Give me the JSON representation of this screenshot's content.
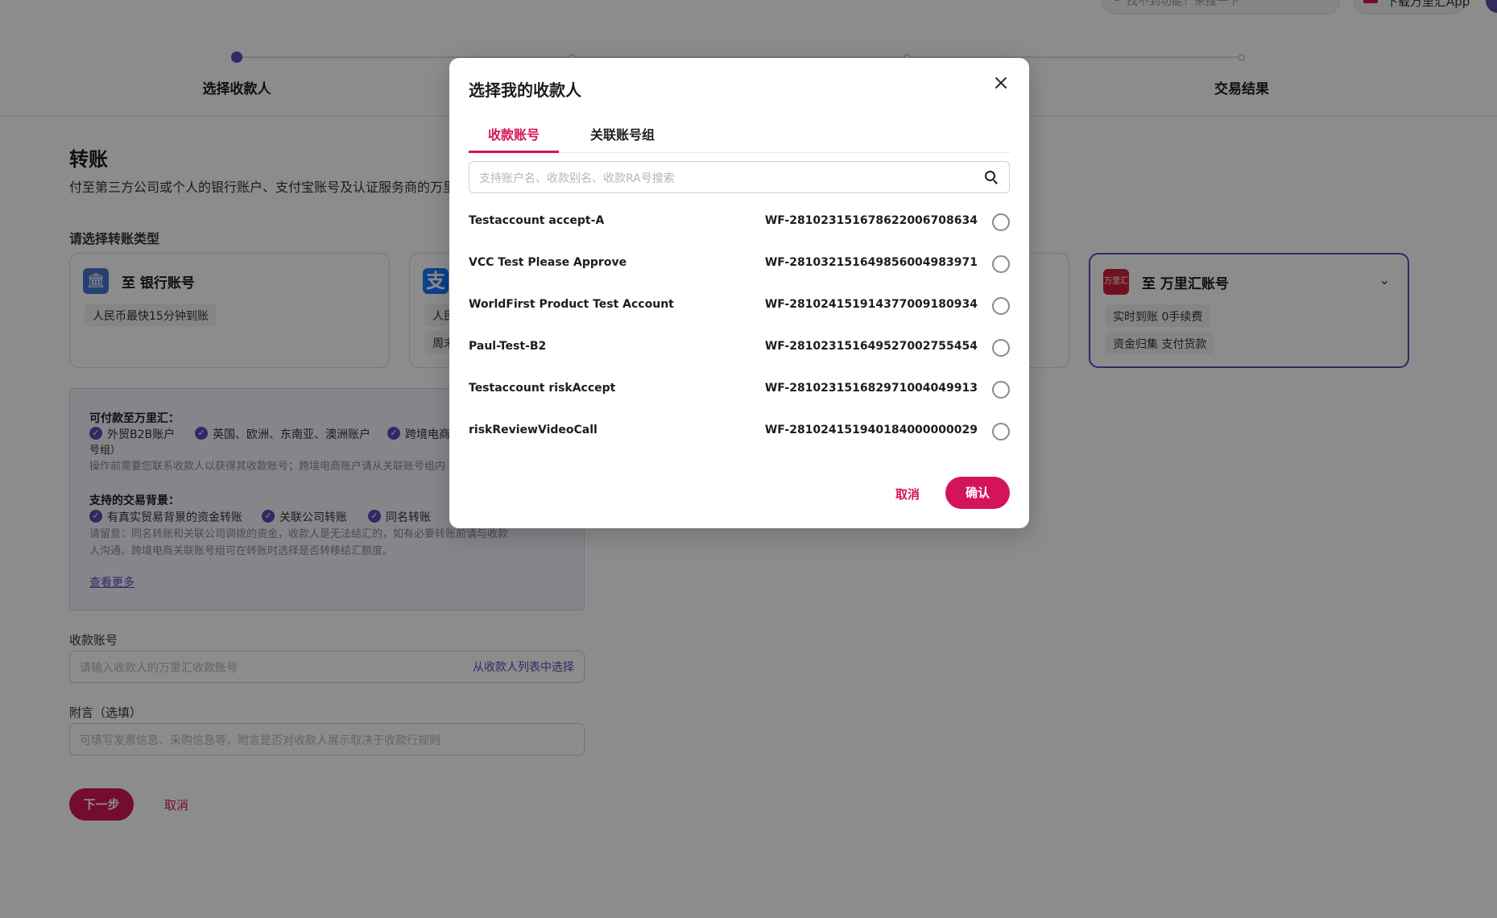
{
  "topbar": {
    "search_text": "找不到功能？来搜一下",
    "app_label": "下载万里汇App"
  },
  "stepper": {
    "steps": [
      {
        "label": "选择收款人"
      },
      {
        "label": ""
      },
      {
        "label": ""
      },
      {
        "label": "交易结果"
      }
    ]
  },
  "page": {
    "title": "转账",
    "description": "付至第三方公司或个人的银行账户、支付宝账号及认证服务商的万里",
    "type_section_label": "请选择转账类型",
    "cards": {
      "bank": {
        "title": "至 银行账号",
        "tags": [
          "人民币最快15分钟到账"
        ]
      },
      "alipay": {
        "tags": [
          "人民",
          "周末"
        ]
      },
      "wf": {
        "title": "至 万里汇账号",
        "icon_text": "万里汇",
        "tags": [
          "实时到账 0手续费",
          "资金归集 支付货款"
        ]
      }
    },
    "info": {
      "payable_heading": "可付款至万里汇：",
      "payable_items": [
        "外贸B2B账户",
        "英国、欧洲、东南亚、澳洲账户",
        "跨境电商"
      ],
      "payable_wrap": "号组）",
      "payable_note": "操作前需要您联系收款人以获得其收款账号；跨境电商账户请从关联账号组内",
      "support_heading": "支持的交易背景：",
      "support_items": [
        "有真实贸易背景的资金转账",
        "关联公司转账",
        "同名转账"
      ],
      "support_note_1": "请留意：同名转账和关联公司调拨的资金，收款人是无法结汇的，如有必要转账前请与收款",
      "support_note_2": "人沟通。跨境电商关联账号组可在转账时选择是否转移结汇额度。",
      "more_link": "查看更多"
    },
    "account_label": "收款账号",
    "account_placeholder": "请输入收款人的万里汇收款账号",
    "account_select_link": "从收款人列表中选择",
    "memo_label": "附言（选填）",
    "memo_placeholder": "可填写发票信息、采购信息等，附言是否对收款人展示取决于收款行规则",
    "next_button": "下一步",
    "cancel_button": "取消"
  },
  "modal": {
    "title": "选择我的收款人",
    "tabs": [
      "收款账号",
      "关联账号组"
    ],
    "search_placeholder": "支持账户名、收款别名、收款RA号搜索",
    "payees": [
      {
        "name": "Testaccount accept-A",
        "account": "WF-2810231516786220067086​34"
      },
      {
        "name": "VCC Test Please Approve",
        "account": "WF-28103215164985600498397​1"
      },
      {
        "name": "WorldFirst Product Test Account",
        "account": "WF-28102415191437700918093​4"
      },
      {
        "name": "Paul-Test-B2",
        "account": "WF-28102315164952700275545​4"
      },
      {
        "name": "Testaccount riskAccept",
        "account": "WF-28102315168297100404991​3"
      },
      {
        "name": "riskReviewVideoCall",
        "account": "WF-28102415194018400000002​9"
      }
    ],
    "cancel_label": "取消",
    "confirm_label": "确认"
  },
  "colors": {
    "brand_pink": "#d4145a",
    "accent_purple": "#5b4ab8"
  }
}
